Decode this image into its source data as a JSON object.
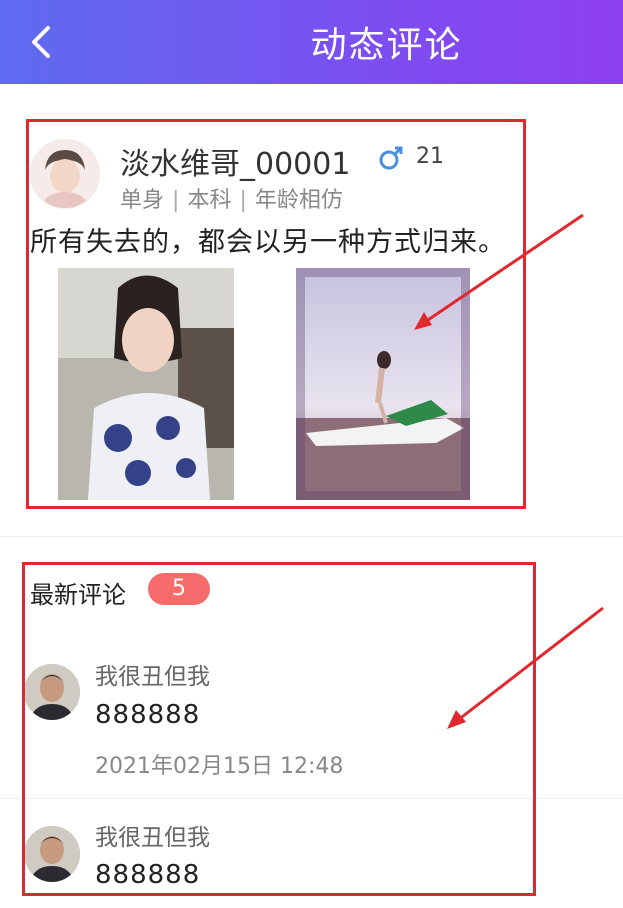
{
  "header": {
    "title": "动态评论",
    "back_icon": "back-arrow-icon"
  },
  "post": {
    "username": "淡水维哥_00001",
    "gender_icon": "male-icon",
    "age": "21",
    "tags": [
      "单身",
      "本科",
      "年龄相仿"
    ],
    "text": "所有失去的，都会以另一种方式归来。",
    "photos": [
      "photo-woman-portrait",
      "photo-jetski-beach"
    ]
  },
  "comments_section": {
    "title": "最新评论",
    "count": "5",
    "items": [
      {
        "name": "我很丑但我",
        "body": "888888",
        "time": "2021年02月15日 12:48"
      },
      {
        "name": "我很丑但我",
        "body": "888888"
      }
    ]
  },
  "colors": {
    "header_start": "#5e6bf0",
    "header_end": "#8e3ff0",
    "badge": "#f66c6c",
    "annotation": "#e0282e"
  }
}
